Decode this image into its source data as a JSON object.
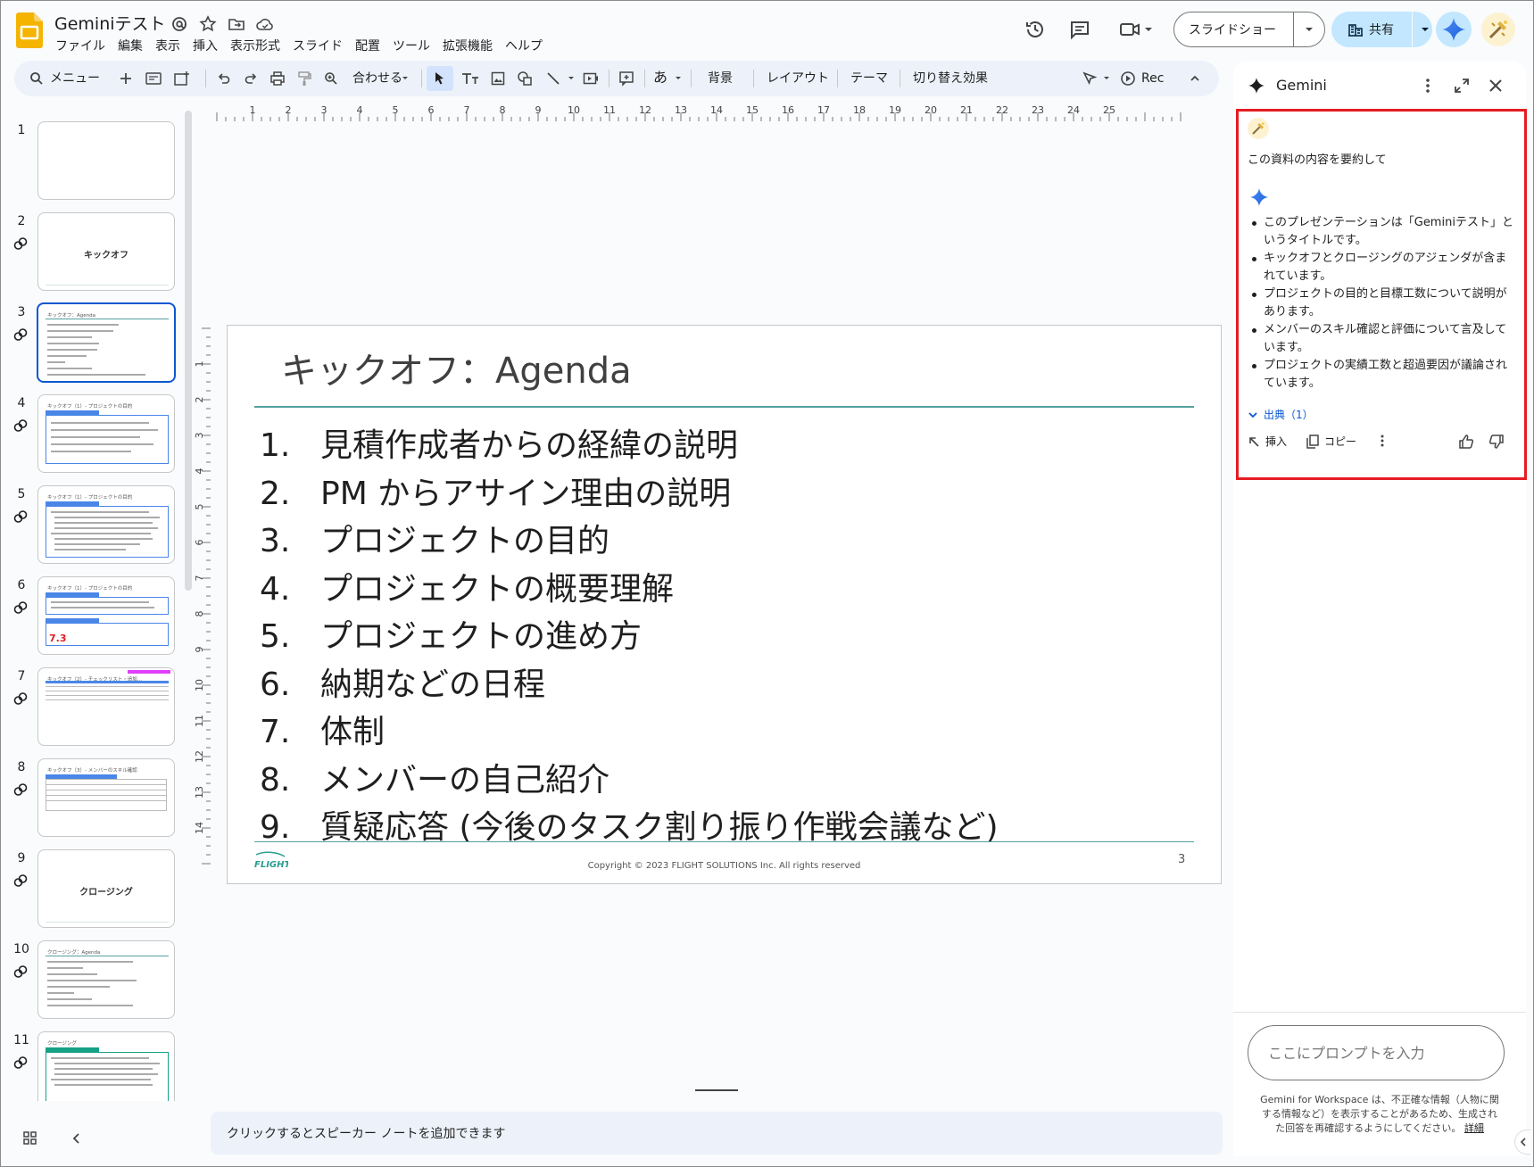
{
  "title_bar": {
    "doc_title": "Geminiテスト",
    "menus": [
      "ファイル",
      "編集",
      "表示",
      "挿入",
      "表示形式",
      "スライド",
      "配置",
      "ツール",
      "拡張機能",
      "ヘルプ"
    ],
    "slideshow_label": "スライドショー",
    "share_label": "共有",
    "icons": [
      "slides-logo-icon",
      "mention-icon",
      "star-icon",
      "move-to-folder-icon",
      "cloud-saved-icon",
      "history-icon",
      "comment-icon",
      "meet-camera-icon",
      "dropdown-icon",
      "building-icon",
      "gemini-icon",
      "avatar"
    ]
  },
  "toolbar": {
    "search_label": "メニュー",
    "zoom_label": "合わせる",
    "kana_label": "あ",
    "background_label": "背景",
    "layout_label": "レイアウト",
    "theme_label": "テーマ",
    "transition_label": "切り替え効果",
    "rec_label": "Rec"
  },
  "filmstrip": {
    "slides": [
      {
        "num": "1"
      },
      {
        "num": "2",
        "center": "キックオフ"
      },
      {
        "num": "3",
        "title": "キックオフ：Agenda",
        "selected": true
      },
      {
        "num": "4",
        "title": "キックオフ（1）- プロジェクトの目的"
      },
      {
        "num": "5",
        "title": "キックオフ（1）- プロジェクトの目的"
      },
      {
        "num": "6",
        "title": "キックオフ（1）- プロジェクトの目的",
        "big": "7.3"
      },
      {
        "num": "7",
        "title": "キックオフ（2）- チェックリスト・追加..."
      },
      {
        "num": "8",
        "title": "キックオフ（3）- メンバーのスキル確認"
      },
      {
        "num": "9",
        "center": "クロージング"
      },
      {
        "num": "10",
        "title": "クロージング：Agenda"
      },
      {
        "num": "11",
        "title": "クロージング"
      }
    ]
  },
  "ruler": {
    "h_ticks": [
      "1",
      "2",
      "3",
      "4",
      "5",
      "6",
      "7",
      "8",
      "9",
      "10",
      "11",
      "12",
      "13",
      "14",
      "15",
      "16",
      "17",
      "18",
      "19",
      "20",
      "21",
      "22",
      "23",
      "24",
      "25"
    ],
    "v_ticks": [
      "1",
      "2",
      "3",
      "4",
      "5",
      "6",
      "7",
      "8",
      "9",
      "10",
      "11",
      "12",
      "13",
      "14"
    ]
  },
  "slide": {
    "title": "キックオフ：Agenda",
    "items": [
      {
        "n": "1.",
        "text": "見積作成者からの経緯の説明"
      },
      {
        "n": "2.",
        "text": "PM からアサイン理由の説明"
      },
      {
        "n": "3.",
        "text": "プロジェクトの目的"
      },
      {
        "n": "4.",
        "text": "プロジェクトの概要理解"
      },
      {
        "n": "5.",
        "text": "プロジェクトの進め方"
      },
      {
        "n": "6.",
        "text": "納期などの日程"
      },
      {
        "n": "7.",
        "text": "体制"
      },
      {
        "n": "8.",
        "text": "メンバーの自己紹介"
      },
      {
        "n": "9.",
        "text": "質疑応答 (今後のタスク割り振り作戦会議など)"
      }
    ],
    "logo_text": "FLIGHT",
    "copyright": "Copyright ©  2023 FLIGHT SOLUTIONS Inc. All rights reserved",
    "page_number": "3"
  },
  "notes": {
    "placeholder": "クリックするとスピーカー ノートを追加できます"
  },
  "gemini_panel": {
    "title": "Gemini",
    "user_prompt": "この資料の内容を要約して",
    "response": [
      "このプレゼンテーションは「Geminiテスト」というタイトルです。",
      "キックオフとクロージングのアジェンダが含まれています。",
      "プロジェクトの目的と目標工数について説明があります。",
      "メンバーのスキル確認と評価について言及しています。",
      "プロジェクトの実績工数と超過要因が議論されています。"
    ],
    "sources_label": "出典（1）",
    "insert_label": "挿入",
    "copy_label": "コピー",
    "prompt_placeholder": "ここにプロンプトを入力",
    "disclaimer": "Gemini for Workspace は、不正確な情報（人物に関する情報など）を表示することがあるため、生成された回答を再確認するようにしてください。",
    "disclaimer_link": "詳細"
  },
  "colors": {
    "accent": "#0b57d0",
    "highlight": "#e51c23",
    "slide_rule": "#54a0a0",
    "share_bg": "#c2e7ff"
  }
}
